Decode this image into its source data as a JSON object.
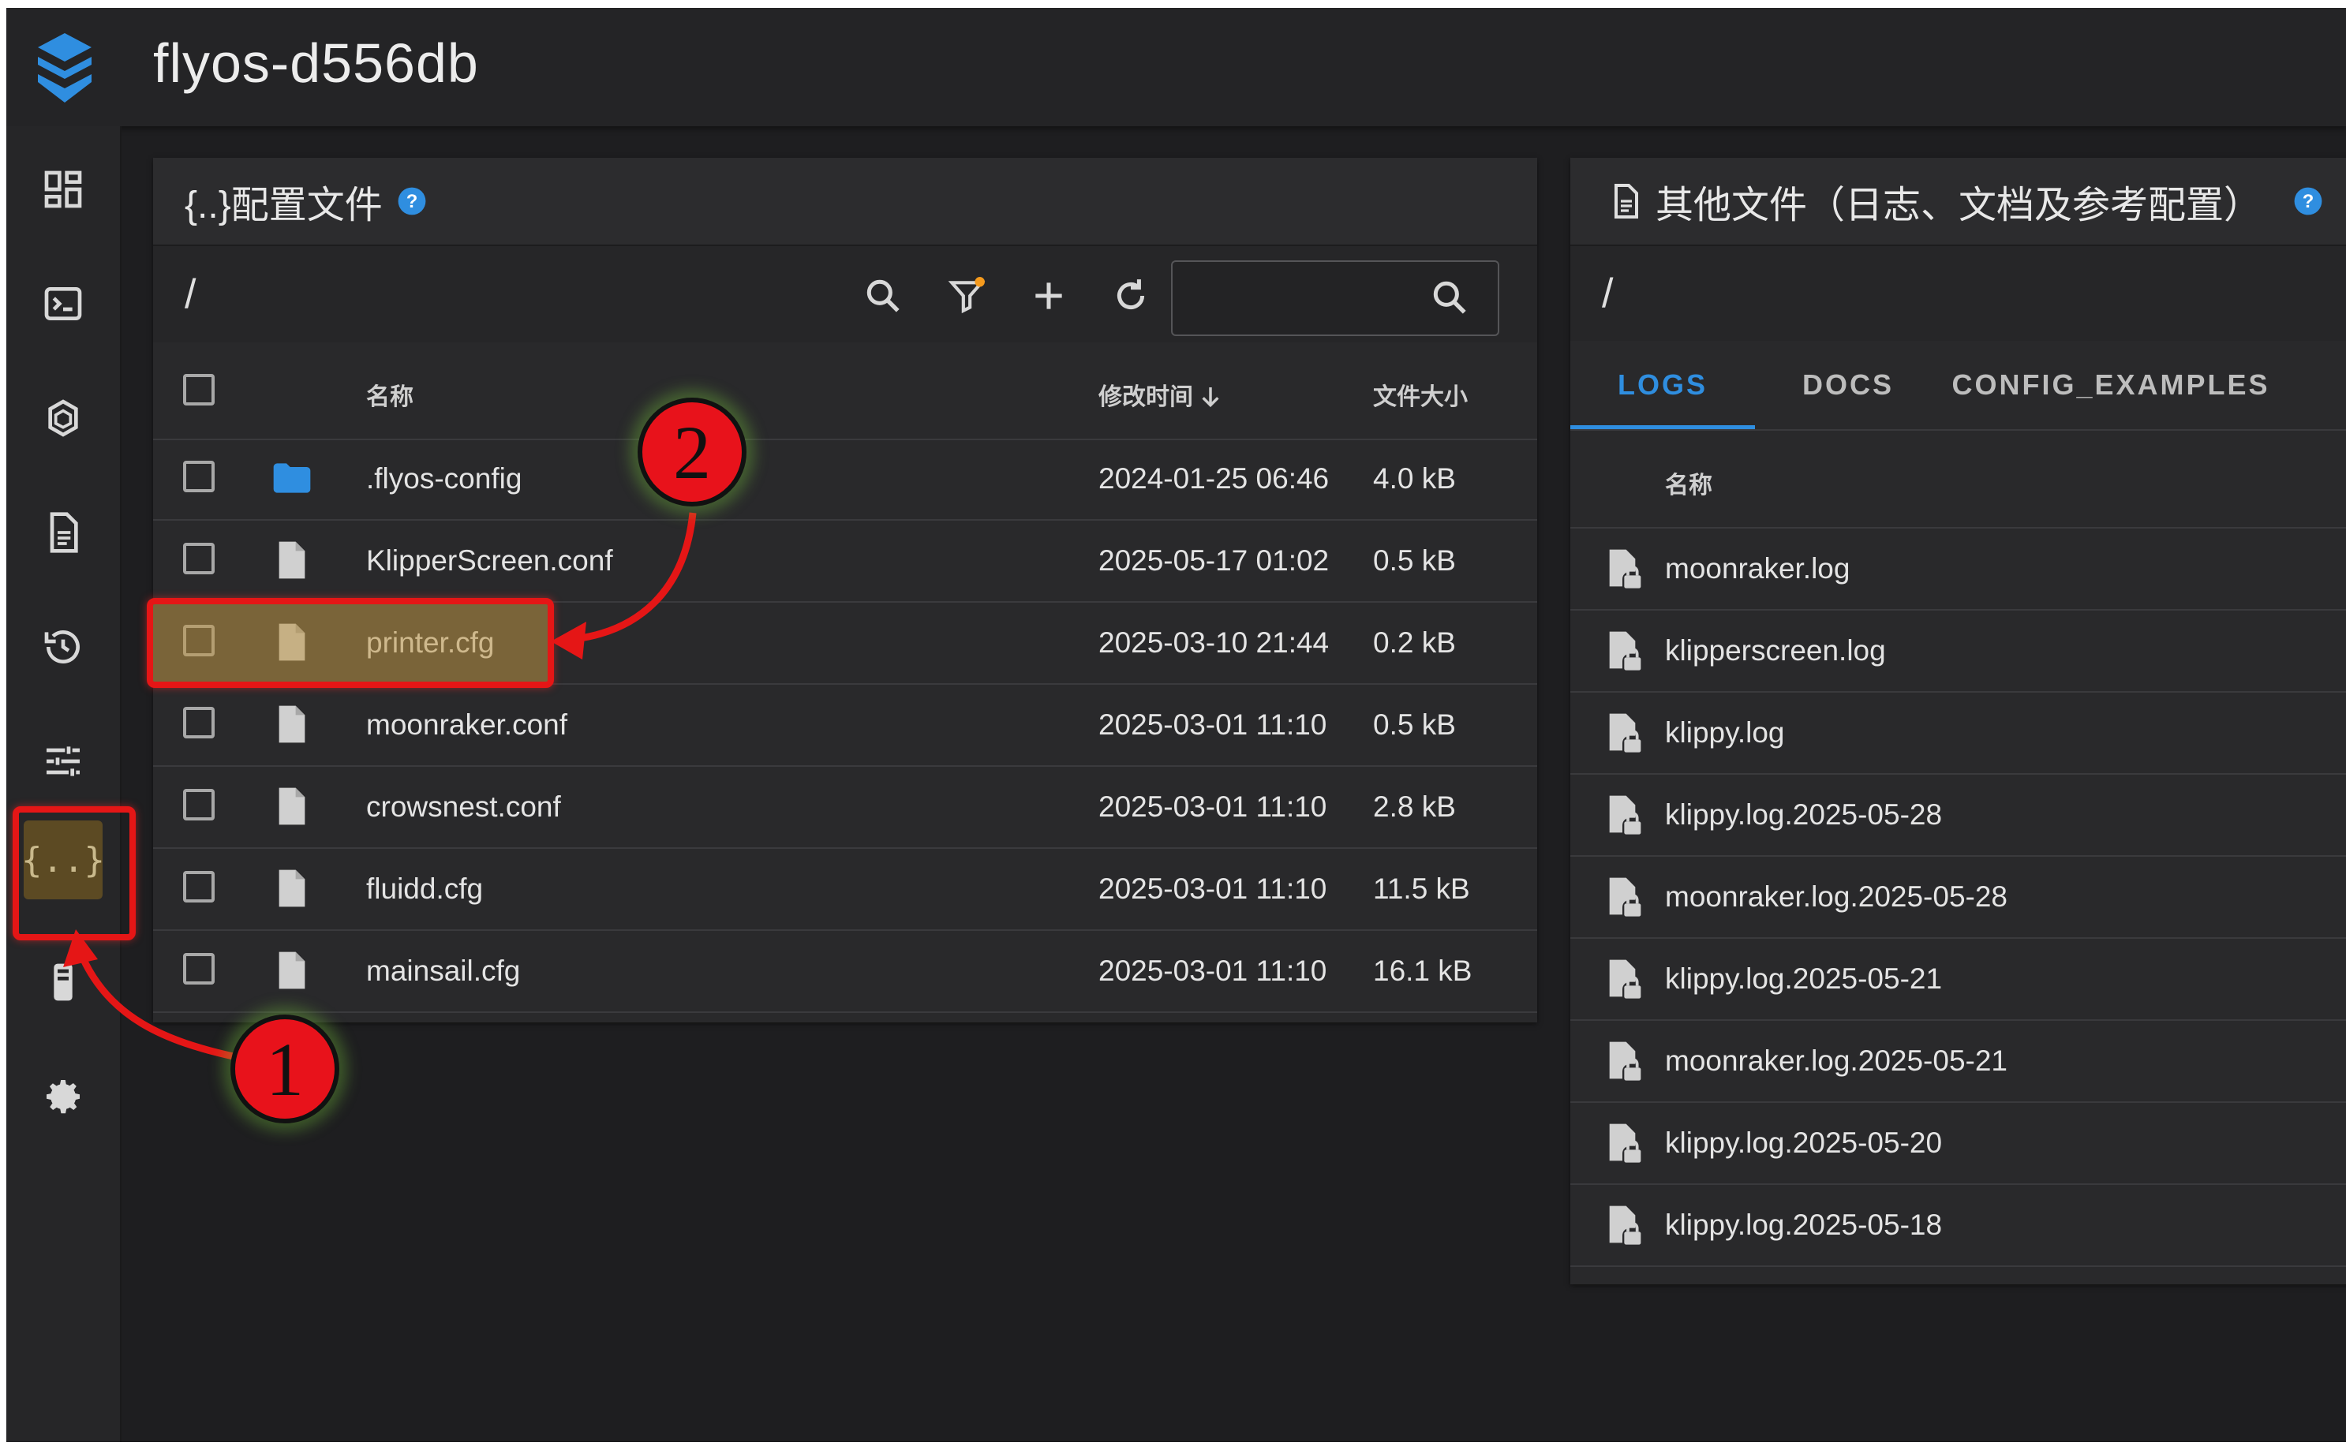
{
  "app": {
    "title": "flyos-d556db"
  },
  "colors": {
    "accent": "#2f8ee0",
    "folder": "#2f8ee0",
    "highlight": "#e51616",
    "warning_dot": "#f59a1d"
  },
  "sidebar": {
    "items": [
      {
        "name": "dashboard-icon"
      },
      {
        "name": "console-icon"
      },
      {
        "name": "jobs-icon"
      },
      {
        "name": "file-icon"
      },
      {
        "name": "history-icon"
      },
      {
        "name": "tune-icon"
      },
      {
        "name": "config-icon",
        "label": "{..}"
      },
      {
        "name": "system-icon"
      },
      {
        "name": "settings-icon"
      }
    ]
  },
  "config_panel": {
    "title": "{..}配置文件",
    "path": "/",
    "columns": {
      "name": "名称",
      "modified": "修改时间",
      "size": "文件大小"
    },
    "files": [
      {
        "name": ".flyos-config",
        "modified": "2024-01-25 06:46",
        "size": "4.0 kB",
        "type": "folder"
      },
      {
        "name": "KlipperScreen.conf",
        "modified": "2025-05-17 01:02",
        "size": "0.5 kB",
        "type": "file"
      },
      {
        "name": "printer.cfg",
        "modified": "2025-03-10 21:44",
        "size": "0.2 kB",
        "type": "file"
      },
      {
        "name": "moonraker.conf",
        "modified": "2025-03-01 11:10",
        "size": "0.5 kB",
        "type": "file"
      },
      {
        "name": "crowsnest.conf",
        "modified": "2025-03-01 11:10",
        "size": "2.8 kB",
        "type": "file"
      },
      {
        "name": "fluidd.cfg",
        "modified": "2025-03-01 11:10",
        "size": "11.5 kB",
        "type": "file"
      },
      {
        "name": "mainsail.cfg",
        "modified": "2025-03-01 11:10",
        "size": "16.1 kB",
        "type": "file"
      }
    ]
  },
  "other_panel": {
    "title": "其他文件（日志、文档及参考配置）",
    "path": "/",
    "tabs": [
      {
        "label": "LOGS",
        "active": true
      },
      {
        "label": "DOCS",
        "active": false
      },
      {
        "label": "CONFIG_EXAMPLES",
        "active": false
      }
    ],
    "column_name": "名称",
    "files": [
      "moonraker.log",
      "klipperscreen.log",
      "klippy.log",
      "klippy.log.2025-05-28",
      "moonraker.log.2025-05-28",
      "klippy.log.2025-05-21",
      "moonraker.log.2025-05-21",
      "klippy.log.2025-05-20",
      "klippy.log.2025-05-18"
    ]
  },
  "annotations": {
    "badge1": "1",
    "badge2": "2"
  }
}
